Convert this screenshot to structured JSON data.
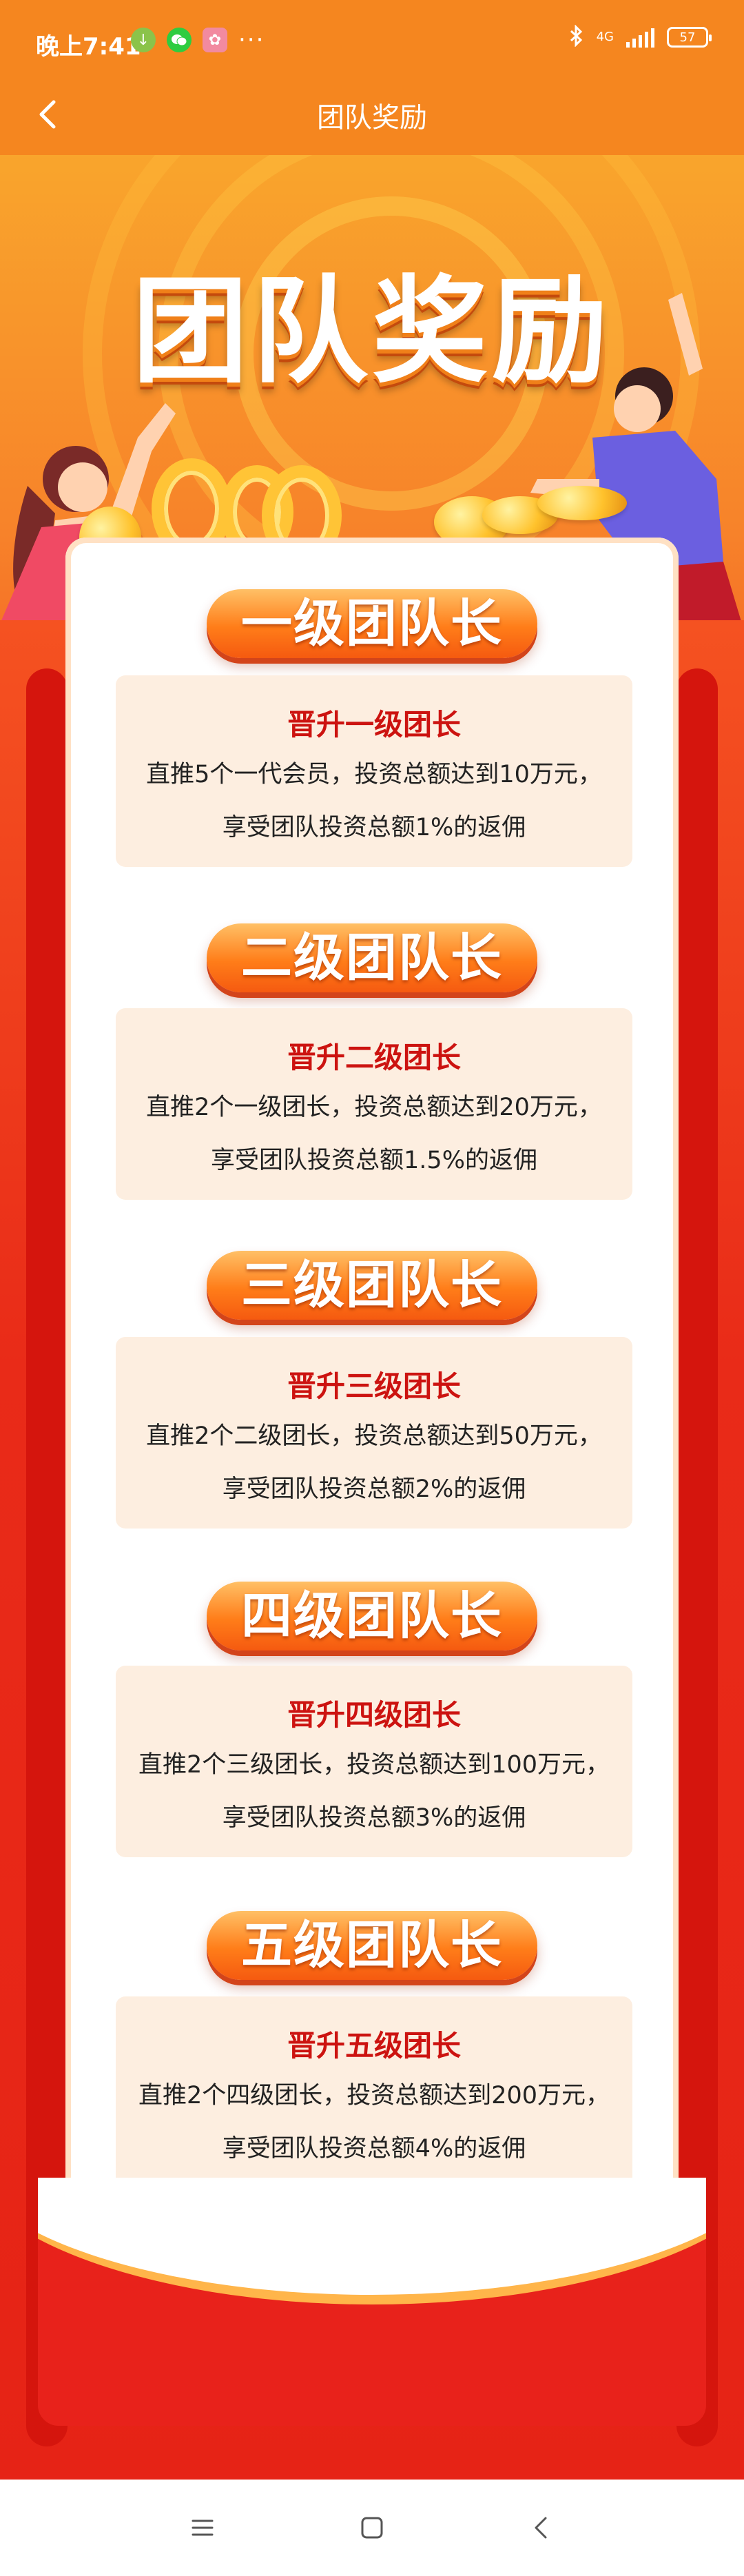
{
  "status_bar": {
    "time": "晚上7:41",
    "network": "4G",
    "battery": "57",
    "more": "···"
  },
  "header": {
    "title": "团队奖励"
  },
  "hero": {
    "title": "团队奖励"
  },
  "levels": [
    {
      "name": "一级团队长",
      "title": "晋升一级团长",
      "line1": "直推5个一代会员，投资总额达到10万元，",
      "line2": "享受团队投资总额1%的返佣"
    },
    {
      "name": "二级团队长",
      "title": "晋升二级团长",
      "line1": "直推2个一级团长，投资总额达到20万元，",
      "line2": "享受团队投资总额1.5%的返佣"
    },
    {
      "name": "三级团队长",
      "title": "晋升三级团长",
      "line1": "直推2个二级团长，投资总额达到50万元，",
      "line2": "享受团队投资总额2%的返佣"
    },
    {
      "name": "四级团队长",
      "title": "晋升四级团长",
      "line1": "直推2个三级团长，投资总额达到100万元，",
      "line2": "享受团队投资总额3%的返佣"
    },
    {
      "name": "五级团队长",
      "title": "晋升五级团长",
      "line1": "直推2个四级团长，投资总额达到200万元，",
      "line2": "享受团队投资总额4%的返佣"
    }
  ],
  "icons": {
    "back": "chevron-left-icon",
    "download": "download-icon",
    "wechat": "wechat-icon",
    "app": "app-icon",
    "bluetooth": "bluetooth-icon",
    "signal": "signal-icon",
    "battery": "battery-icon",
    "nav_menu": "menu-icon",
    "nav_home": "home-icon",
    "nav_back": "back-icon"
  },
  "colors": {
    "header_orange": "#f5861f",
    "accent_red": "#cc1310",
    "card_box": "#fdeee0"
  }
}
